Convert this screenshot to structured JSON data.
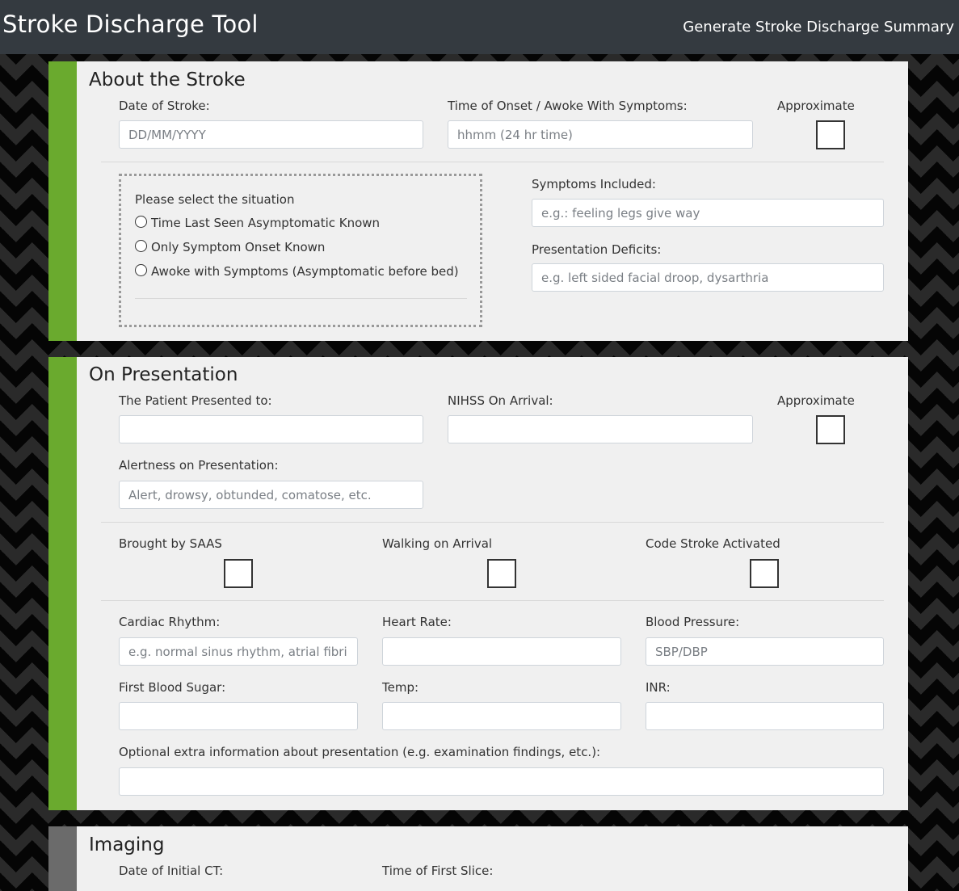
{
  "header": {
    "title": "Stroke Discharge Tool",
    "generate_link": "Generate Stroke Discharge Summary"
  },
  "about": {
    "title": "About the Stroke",
    "date_label": "Date of Stroke:",
    "date_placeholder": "DD/MM/YYYY",
    "time_label": "Time of Onset / Awoke With Symptoms:",
    "time_placeholder": "hhmm (24 hr time)",
    "approx_label": "Approximate",
    "situation": {
      "prompt": "Please select the situation",
      "options": [
        "Time Last Seen Asymptomatic Known",
        "Only Symptom Onset Known",
        "Awoke with Symptoms (Asymptomatic before bed)"
      ]
    },
    "symptoms_label": "Symptoms Included:",
    "symptoms_placeholder": "e.g.: feeling legs give way",
    "deficits_label": "Presentation Deficits:",
    "deficits_placeholder": "e.g. left sided facial droop, dysarthria"
  },
  "presentation": {
    "title": "On Presentation",
    "presented_label": "The Patient Presented to:",
    "presented_value": "",
    "nihss_label": "NIHSS On Arrival:",
    "approx_label": "Approximate",
    "alertness_label": "Alertness on Presentation:",
    "alertness_placeholder": "Alert, drowsy, obtunded, comatose, etc.",
    "checks": [
      "Brought by SAAS",
      "Walking on Arrival",
      "Code Stroke Activated"
    ],
    "cardiac_label": "Cardiac Rhythm:",
    "cardiac_placeholder": "e.g. normal sinus rhythm, atrial fibrillation",
    "hr_label": "Heart Rate:",
    "bp_label": "Blood Pressure:",
    "bp_placeholder": "SBP/DBP",
    "sugar_label": "First Blood Sugar:",
    "temp_label": "Temp:",
    "inr_label": "INR:",
    "extra_label": "Optional extra information about presentation (e.g. examination findings, etc.):"
  },
  "imaging": {
    "title": "Imaging",
    "ct_date_label": "Date of Initial CT:",
    "first_slice_label": "Time of First Slice:"
  }
}
